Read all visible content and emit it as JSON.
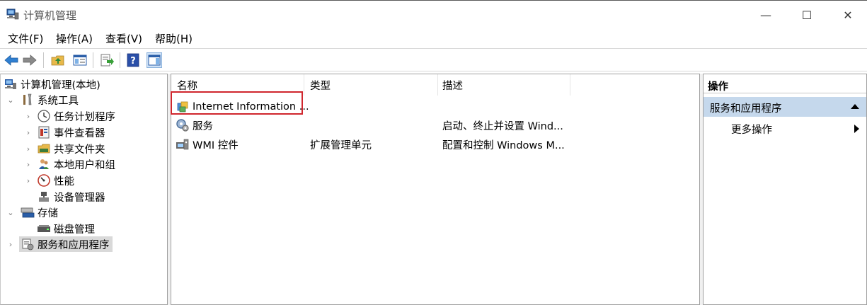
{
  "window": {
    "title": "计算机管理",
    "minimize_glyph": "—",
    "maximize_glyph": "☐",
    "close_glyph": "✕"
  },
  "menu": {
    "file": "文件(F)",
    "action": "操作(A)",
    "view": "查看(V)",
    "help": "帮助(H)"
  },
  "tree": {
    "root": "计算机管理(本地)",
    "system_tools": "系统工具",
    "task_scheduler": "任务计划程序",
    "event_viewer": "事件查看器",
    "shared_folders": "共享文件夹",
    "local_users": "本地用户和组",
    "performance": "性能",
    "device_manager": "设备管理器",
    "storage": "存储",
    "disk_management": "磁盘管理",
    "services_apps": "服务和应用程序"
  },
  "list": {
    "columns": {
      "name": "名称",
      "type": "类型",
      "description": "描述"
    },
    "rows": [
      {
        "name": "Internet Information ...",
        "type": "",
        "description": ""
      },
      {
        "name": "服务",
        "type": "",
        "description": "启动、终止并设置 Wind..."
      },
      {
        "name": "WMI 控件",
        "type": "扩展管理单元",
        "description": "配置和控制 Windows M..."
      }
    ]
  },
  "actions": {
    "header": "操作",
    "group": "服务和应用程序",
    "more": "更多操作"
  },
  "colors": {
    "selection_bg": "#d9d9d9",
    "actions_group_bg": "#c5d8ec",
    "highlight_border": "#d0262d"
  }
}
